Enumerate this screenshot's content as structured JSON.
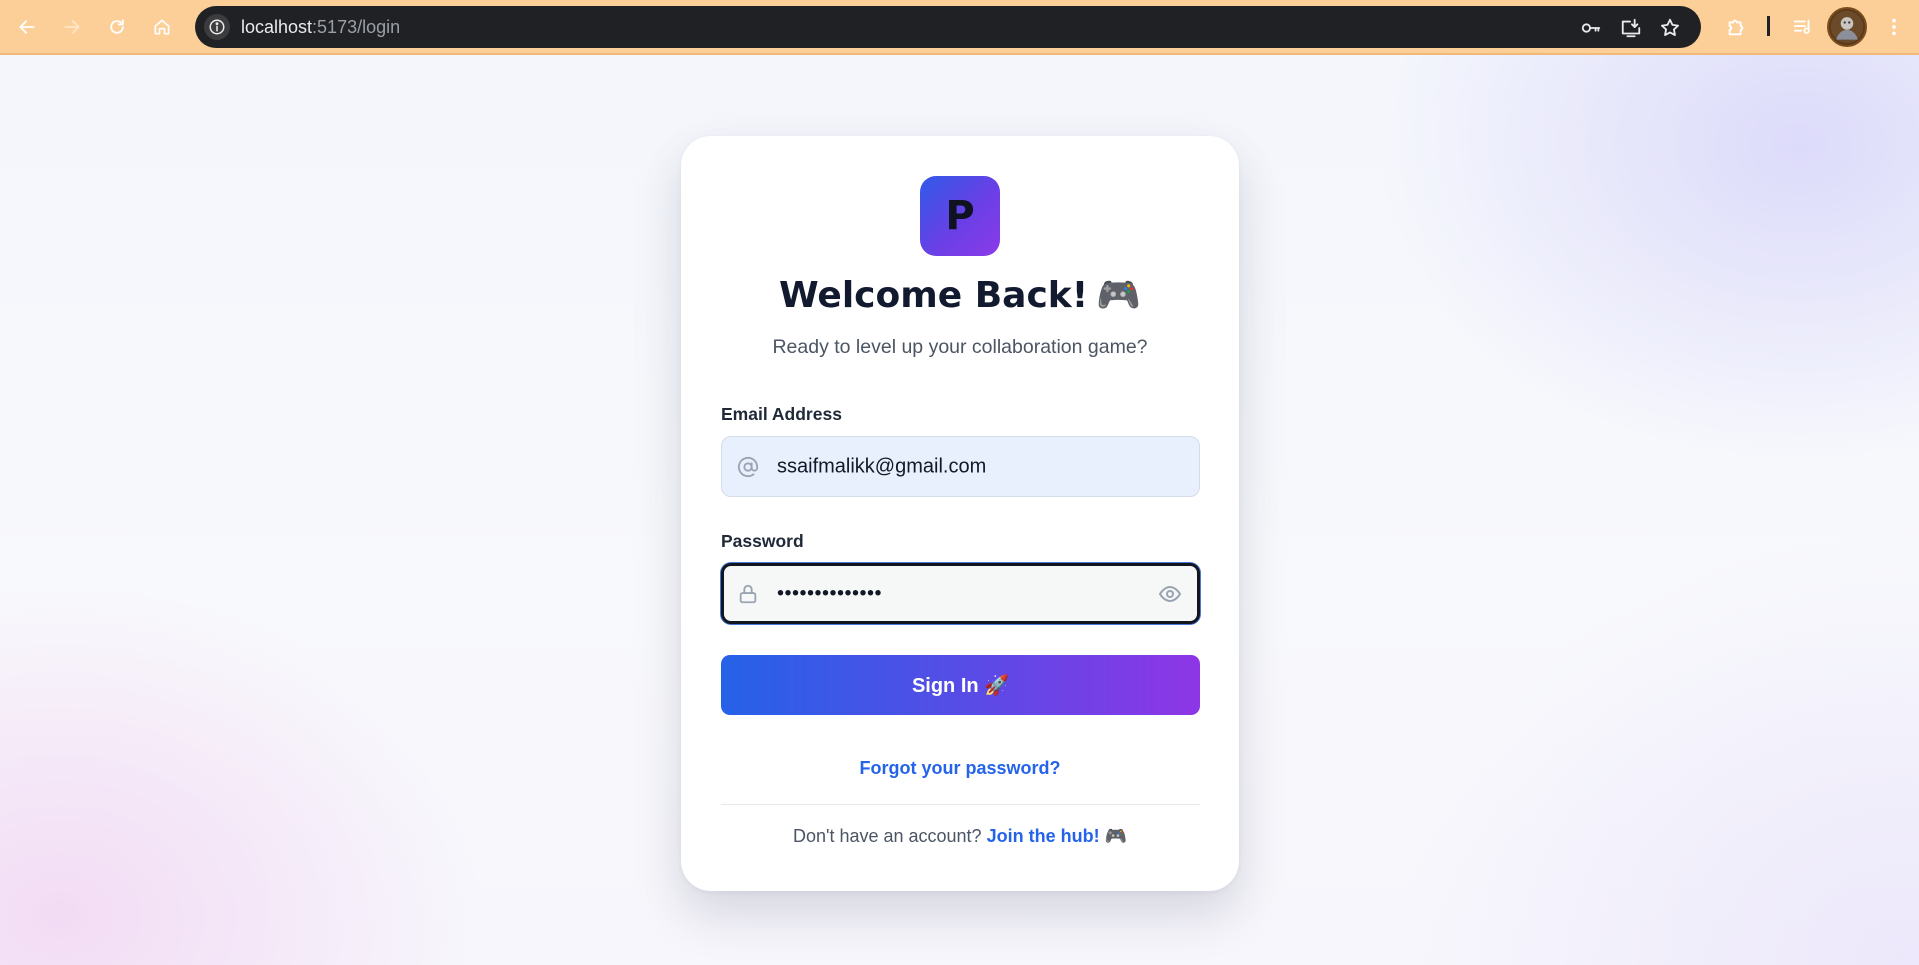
{
  "browser": {
    "url_host": "localhost",
    "url_path": ":5173/login",
    "icons": {
      "back": "back-arrow-icon",
      "forward": "forward-arrow-icon",
      "reload": "reload-icon",
      "home": "home-icon",
      "site_info": "info-icon",
      "passwords": "key-icon",
      "install": "install-app-icon",
      "bookmark": "star-icon",
      "extensions": "puzzle-icon",
      "media": "media-controls-icon",
      "menu": "kebab-menu-icon"
    },
    "colors": {
      "frame": "#fccf98",
      "omnibox": "#202124"
    }
  },
  "card": {
    "logo_letter": "P",
    "title": "Welcome Back!",
    "title_emoji": "🎮",
    "subtitle": "Ready to level up your collaboration game?",
    "email": {
      "label": "Email Address",
      "value": "ssaifmalikk@gmail.com",
      "icon": "at-sign-icon"
    },
    "password": {
      "label": "Password",
      "value": "••••••••••••••",
      "icon": "lock-icon",
      "toggle_icon": "eye-icon"
    },
    "signin_label": "Sign In 🚀",
    "forgot_label": "Forgot your password?",
    "signup_prompt": "Don't have an account?",
    "signup_link": "Join the hub! 🎮",
    "colors": {
      "accent": "#2563eb",
      "gradient_start": "#2562e8",
      "gradient_end": "#8e36e6"
    }
  }
}
